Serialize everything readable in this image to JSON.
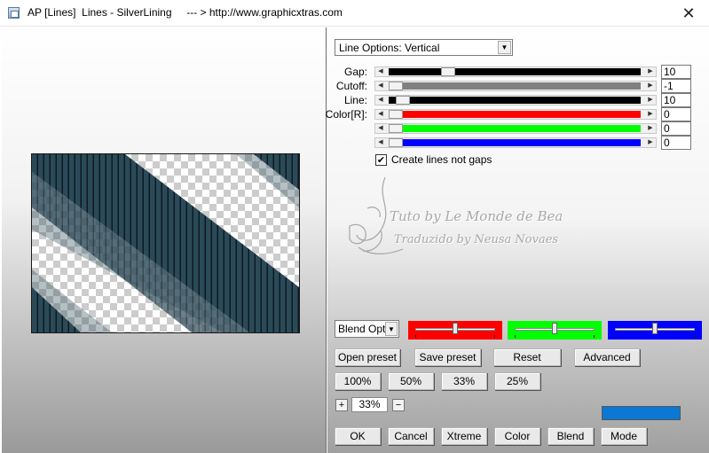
{
  "window": {
    "title": "AP [Lines]  Lines - SilverLining     --- > http://www.graphicxtras.com",
    "close_glyph": "✕"
  },
  "options": {
    "line_options_value": "Line Options: Vertical"
  },
  "sliders": {
    "gap": {
      "label": "Gap:",
      "value": "10",
      "position": 0.22,
      "track_color": "#000000"
    },
    "cutoff": {
      "label": "Cutoff:",
      "value": "-1",
      "position": 0.0,
      "track_color": "#808080"
    },
    "line": {
      "label": "Line:",
      "value": "10",
      "position": 0.03,
      "track_color": "#000000"
    },
    "color_r": {
      "label": "Color[R]:",
      "value": "0",
      "position": 0.0,
      "track_color": "#ff0000"
    },
    "color_g": {
      "label": "",
      "value": "0",
      "position": 0.0,
      "track_color": "#00ff00"
    },
    "color_b": {
      "label": "",
      "value": "0",
      "position": 0.0,
      "track_color": "#0000ff"
    }
  },
  "checkbox": {
    "label": "Create lines not gaps",
    "checked": true,
    "check_glyph": "✔"
  },
  "watermark": {
    "line1": "Tuto by  Le Monde de Bea",
    "line2": "Traduzido by  Neusa Novaes"
  },
  "blend": {
    "select_value": "Blend Optio",
    "red_level": 0.5,
    "green_level": 0.5,
    "blue_level": 0.5,
    "red_color": "#ff0000",
    "green_color": "#00ff00",
    "blue_color": "#0000ff"
  },
  "buttons": {
    "open_preset": "Open preset",
    "save_preset": "Save preset",
    "reset": "Reset",
    "advanced": "Advanced",
    "zoom_100": "100%",
    "zoom_50": "50%",
    "zoom_33": "33%",
    "zoom_25": "25%",
    "ok": "OK",
    "cancel": "Cancel",
    "xtreme": "Xtreme",
    "color": "Color",
    "blend": "Blend",
    "mode": "Mode"
  },
  "zoom": {
    "value": "33%",
    "plus": "+",
    "minus": "−"
  },
  "swatch": {
    "color": "#0a78d4"
  }
}
